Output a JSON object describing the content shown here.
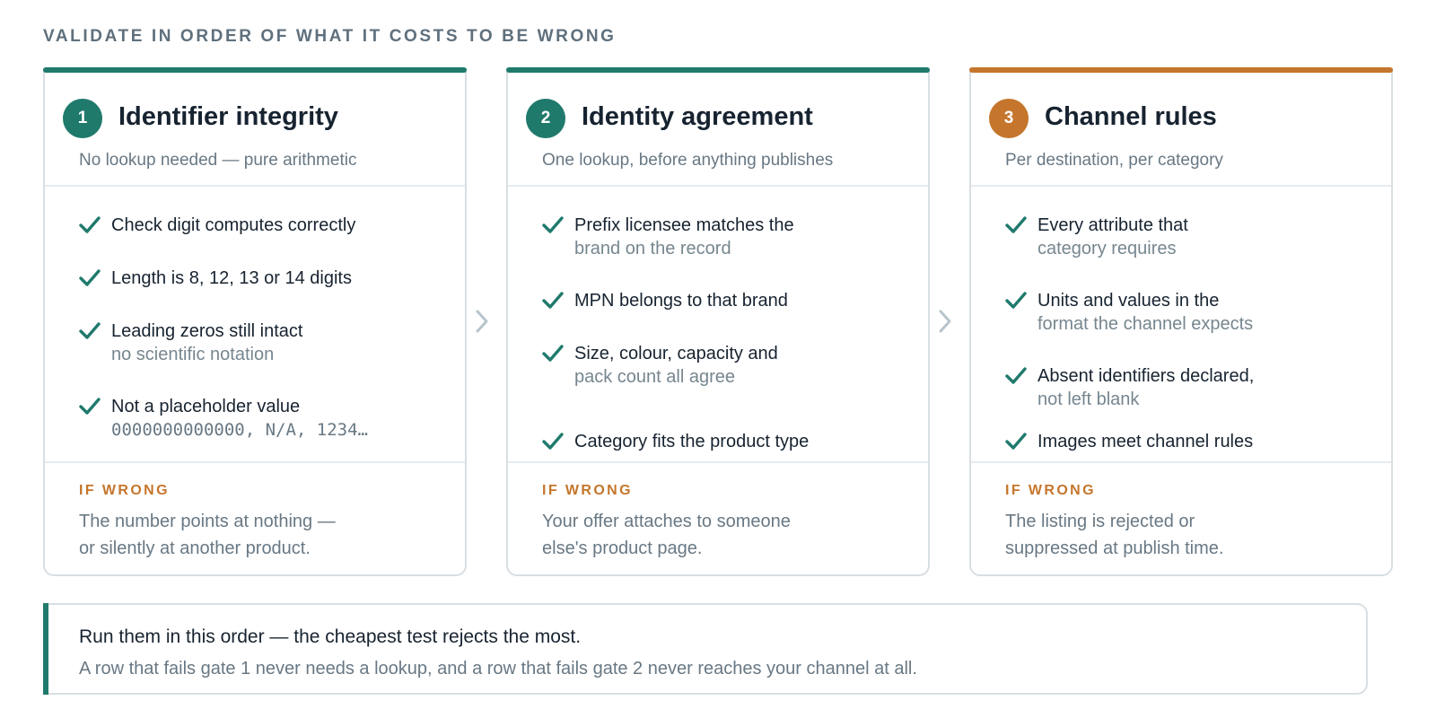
{
  "heading": "VALIDATE IN ORDER OF WHAT IT COSTS TO BE WRONG",
  "colors": {
    "teal": "#1f7a6c",
    "orange": "#c5762c",
    "check": "#1f7a6c",
    "arrow": "#b8c4cb"
  },
  "icons": {
    "check": "check-icon",
    "arrow": "chevron-right-icon"
  },
  "gates": [
    {
      "number": "1",
      "title": "Identifier integrity",
      "subtitle": "No lookup needed — pure arithmetic",
      "accent": "#1f7a6c",
      "checks": [
        {
          "main": "Check digit computes correctly",
          "detail": ""
        },
        {
          "main": "Length is 8, 12, 13 or 14 digits",
          "detail": ""
        },
        {
          "main": "Leading zeros still intact",
          "detail": "no scientific notation"
        },
        {
          "main": "Not a placeholder value",
          "detail": "0000000000000, N/A, 1234…"
        }
      ],
      "if_wrong_label": "IF WRONG",
      "consequence_line1": "The number points at nothing —",
      "consequence_line2": "or silently at another product."
    },
    {
      "number": "2",
      "title": "Identity agreement",
      "subtitle": "One lookup, before anything publishes",
      "accent": "#1f7a6c",
      "checks": [
        {
          "main": "Prefix licensee matches the",
          "detail": "brand on the record"
        },
        {
          "main": "MPN belongs to that brand",
          "detail": ""
        },
        {
          "main": "Size, colour, capacity and",
          "detail": "pack count all agree"
        },
        {
          "main": "Category fits the product type",
          "detail": ""
        }
      ],
      "if_wrong_label": "IF WRONG",
      "consequence_line1": "Your offer attaches to someone",
      "consequence_line2": "else's product page."
    },
    {
      "number": "3",
      "title": "Channel rules",
      "subtitle": "Per destination, per category",
      "accent": "#c5762c",
      "checks": [
        {
          "main": "Every attribute that",
          "detail": "category requires"
        },
        {
          "main": "Units and values in the",
          "detail": "format the channel expects"
        },
        {
          "main": "Absent identifiers declared,",
          "detail": "not left blank"
        },
        {
          "main": "Images meet channel rules",
          "detail": ""
        }
      ],
      "if_wrong_label": "IF WRONG",
      "consequence_line1": "The listing is rejected or",
      "consequence_line2": "suppressed at publish time."
    }
  ],
  "summary": {
    "main": "Run them in this order — the cheapest test rejects the most.",
    "sub": "A row that fails gate 1 never needs a lookup, and a row that fails gate 2 never reaches your channel at all."
  }
}
